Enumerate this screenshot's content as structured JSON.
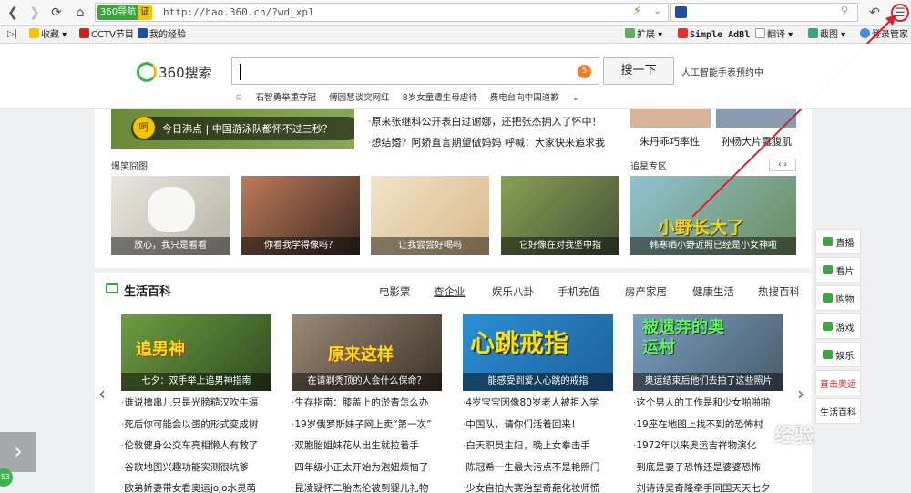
{
  "toolbar": {
    "nav_badge": "360导航",
    "cert_badge": "证",
    "url": "http://hao.360.cn/?wd_xp1"
  },
  "bookmarks": [
    {
      "label": "收藏",
      "icon": "star-icon"
    },
    {
      "label": "CCTV节目",
      "icon": "cctv-icon"
    },
    {
      "label": "我的经验",
      "icon": "paw-icon"
    },
    {
      "label": "扩展",
      "icon": "extension-icon"
    },
    {
      "label": "Simple AdBl",
      "icon": "adblock-icon"
    },
    {
      "label": "翻译",
      "icon": "translate-icon"
    },
    {
      "label": "截图",
      "icon": "scissors-icon"
    },
    {
      "label": "登录管家",
      "icon": "login-icon"
    }
  ],
  "search": {
    "logo": "360搜索",
    "badge": "5",
    "button": "搜一下",
    "hint": "人工智能手表预约中",
    "hot": [
      "石智勇举重夺冠",
      "傅园慧谈突网红",
      "8岁女童遭生母虐待",
      "费电台向中国道歉"
    ]
  },
  "top_feature": {
    "badge": "呵",
    "caption": "今日沸点 | 中国游泳队都怀不过三秒？",
    "news": [
      "原来张继科公开表白过谢娜，还把张杰拥入了怀中！",
      "想结婚？阿娇直言期望傲妈妈 呼喊：大家快来追求我"
    ],
    "stars": [
      "朱丹乖巧率性",
      "孙杨大片露腹肌"
    ]
  },
  "funny": {
    "title": "爆笑囧图",
    "items": [
      "放心，我只是看看",
      "你看我学得像吗？",
      "让我尝尝好喝吗",
      "它好像在对我坚中指"
    ]
  },
  "star_zone": {
    "title": "追星专区",
    "big_text": "小野长大了",
    "caption": "韩寒晒小野近照已经是小女神啦"
  },
  "life": {
    "title": "生活百科",
    "tabs": [
      "电影票",
      "查企业",
      "娱乐八卦",
      "手机充值",
      "房产家居",
      "健康生活",
      "热搜百科"
    ],
    "columns": [
      {
        "img_text": "追男神",
        "caption": "七夕：双手举上追男神指南",
        "items": [
          "谁说撸串儿只是光膀糙汉吹牛逼",
          "死后你可能会以蛋的形式变成树",
          "伦敦健身公交车亮相懒人有救了",
          "谷歌地图兴趣功能实测很坑爹",
          "欧弟娇妻带女看奥运jojo水灵萌"
        ]
      },
      {
        "img_text": "原来这样",
        "caption": "在请剃秃顶的人会什么保命？",
        "items": [
          "生存指南：膝盖上的淤青怎么办",
          "19岁俄罗斯妹子网上卖“第一次”",
          "双胞胎姐妹花从出生就拉着手",
          "四年级小正太开始为泡妞烦恼了",
          "昆凌疑怀二胎杰伦被到婴儿礼物"
        ]
      },
      {
        "img_text": "心跳戒指",
        "caption": "能感受到爱人心跳的戒指",
        "items": [
          "4岁宝宝因像80岁老人被拒入学",
          "中国队，请你们活着回来！",
          "白天职员主妇，晚上女拳击手",
          "陈冠希一生最大污点不是艳照门",
          "少女自拍大赛治型奇葩化妆师慌"
        ]
      },
      {
        "img_text": "被遗弃的奥运村",
        "caption": "奥运结束后他们去拍了这些照片",
        "items": [
          "这个男人的工作是和少女啪啪啪",
          "19座在地图上找不到的恐怖村",
          "1972年以来奥运吉祥物演化",
          "到底是妻子恐怖还是婆婆恐怖",
          "刘诗诗吴奇隆牵手同国天天七夕"
        ]
      }
    ]
  },
  "sidebar": [
    "直播",
    "看片",
    "购物",
    "游戏",
    "娱乐",
    "直击奥运",
    "生活百科"
  ],
  "watermark": "经验",
  "float_badge": "53"
}
